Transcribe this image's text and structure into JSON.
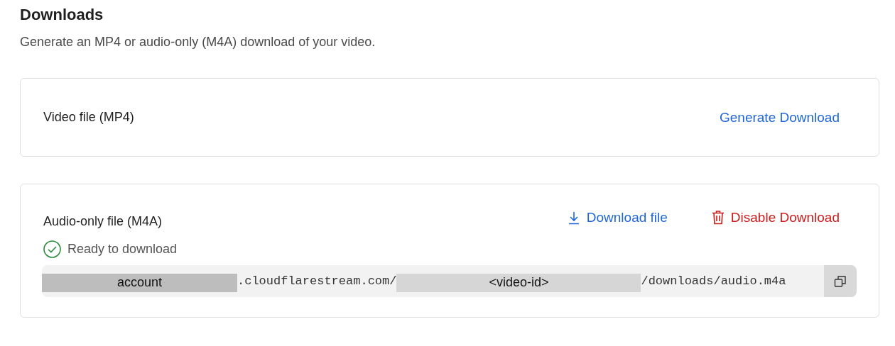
{
  "section": {
    "title": "Downloads",
    "description": "Generate an MP4 or audio-only (M4A) download of your video."
  },
  "cards": [
    {
      "label": "Video file (MP4)",
      "actions": [
        {
          "kind": "generate",
          "label": "Generate Download"
        }
      ]
    },
    {
      "label": "Audio-only file (M4A)",
      "actions": [
        {
          "kind": "download",
          "label": "Download file"
        },
        {
          "kind": "disable",
          "label": "Disable Download"
        }
      ],
      "status": {
        "kind": "ready",
        "label": "Ready to download"
      },
      "url": [
        {
          "kind": "redaction",
          "text": "account"
        },
        {
          "kind": "text",
          "text": ".cloudflarestream.com/"
        },
        {
          "kind": "redaction",
          "text": "<video-id>"
        },
        {
          "kind": "text",
          "text": "/downloads/audio.m4a"
        }
      ]
    }
  ]
}
